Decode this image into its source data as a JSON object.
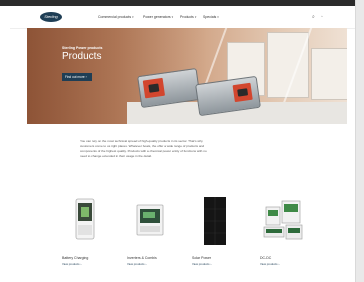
{
  "header": {
    "logo_text": "Sterling",
    "nav": [
      {
        "label": "Commercial products"
      },
      {
        "label": "Power generators"
      },
      {
        "label": "Products"
      },
      {
        "label": "Specials"
      }
    ]
  },
  "hero": {
    "eyebrow": "Sterling Power products",
    "title": "Products",
    "button_label": "Find out more"
  },
  "intro": {
    "text": "You can rely on the most technical spread of high-quality products in its sector. That's why customers come to us right places. Whatever boats, the offer a wide range of products and components of the highest quality. Products with a chemical power entity of functions with no need to change extended in their usage in the detail."
  },
  "cards": [
    {
      "label": "Battery Charging",
      "link": "View products"
    },
    {
      "label": "Inverters & Combis",
      "link": "View products"
    },
    {
      "label": "Solar Power",
      "link": "View products"
    },
    {
      "label": "DC-DC",
      "link": "View products"
    }
  ],
  "colors": {
    "brand": "#1f3e55",
    "accent": "#d2462e",
    "hero_warm": "#c38763"
  }
}
